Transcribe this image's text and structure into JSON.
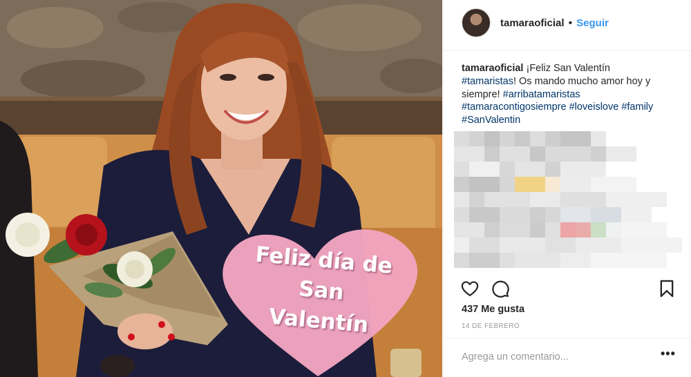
{
  "photo": {
    "heart_text_lines": [
      "Feliz día de",
      "San",
      "Valentín"
    ]
  },
  "header": {
    "username": "tamaraoficial",
    "separator": "•",
    "follow_label": "Seguir"
  },
  "caption": {
    "username": "tamaraoficial",
    "text_1": "¡Feliz San Valentín",
    "tag_1": "#tamaristas",
    "text_2": "! Os mando mucho amor hoy y siempre! ",
    "tag_2": "#arribatamaristas",
    "tag_3": "#tamaracontigosiempre",
    "tag_4": "#loveislove",
    "tag_5": "#family",
    "tag_6": "#SanValentin"
  },
  "actions": {
    "like_icon": "heart-outline-icon",
    "comment_icon": "speech-bubble-icon",
    "save_icon": "bookmark-icon"
  },
  "likes": "437 Me gusta",
  "date": "14 DE FEBRERO",
  "comment": {
    "placeholder": "Agrega un comentario...",
    "more_label": "•••"
  },
  "colors": {
    "link_blue": "#3897f0",
    "hashtag": "#003569",
    "muted": "#999999",
    "heart_pink": "#f4a6c0"
  }
}
